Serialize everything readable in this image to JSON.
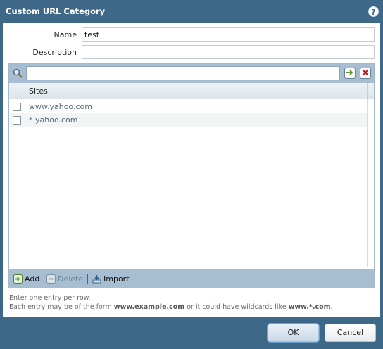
{
  "dialog": {
    "title": "Custom URL Category",
    "help_glyph": "?"
  },
  "form": {
    "name_label": "Name",
    "name_value": "test",
    "description_label": "Description",
    "description_value": ""
  },
  "grid": {
    "search_value": "",
    "column_header": "Sites",
    "rows": [
      {
        "site": "www.yahoo.com",
        "checked": false
      },
      {
        "site": "*.yahoo.com",
        "checked": false
      }
    ],
    "footer": {
      "add_label": "Add",
      "delete_label": "Delete",
      "import_label": "Import"
    }
  },
  "hints": {
    "line1": "Enter one entry per row.",
    "line2_pre": "Each entry may be of the form ",
    "line2_example": "www.example.com",
    "line2_mid": " or it could have wildcards like ",
    "line2_wild": "www.*.com",
    "line2_end": "."
  },
  "buttons": {
    "ok_label": "OK",
    "cancel_label": "Cancel"
  },
  "colors": {
    "chrome": "#3e6887",
    "toolbar": "#a7bed2"
  }
}
